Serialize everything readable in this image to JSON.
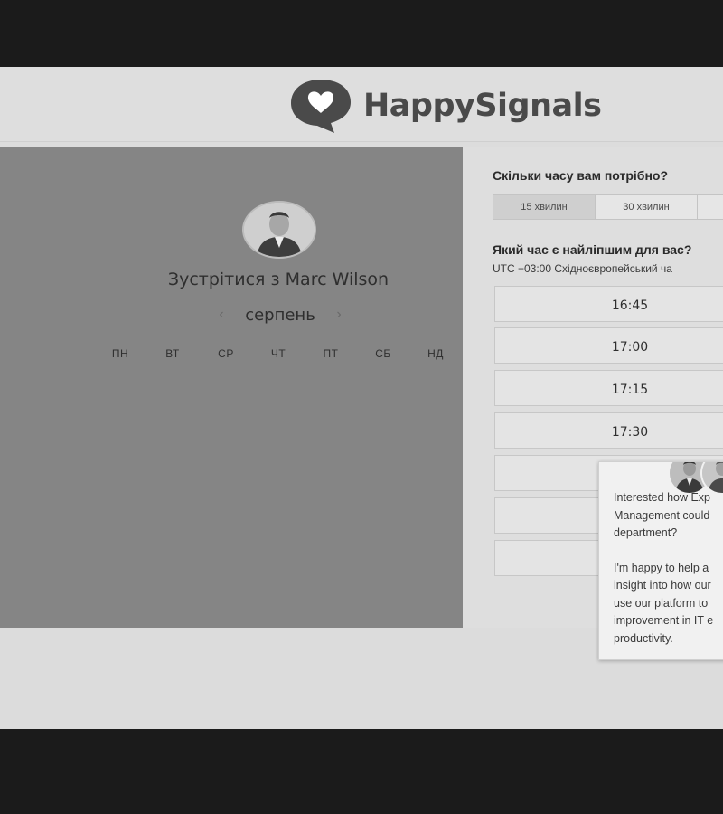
{
  "header": {
    "logo_text": "HappySignals"
  },
  "left_panel": {
    "meet_title": "Зустрітися з Marc Wilson",
    "month": "серпень",
    "prev_icon": "chevron-left-icon",
    "next_icon": "chevron-right-icon",
    "weekdays": [
      "ПН",
      "ВТ",
      "СР",
      "ЧТ",
      "ПТ",
      "СБ",
      "НД"
    ]
  },
  "booking": {
    "duration_question": "Скільки часу вам потрібно?",
    "durations": [
      "15 хвилин",
      "30 хвилин"
    ],
    "selected_duration": "15 хвилин",
    "time_question": "Який час є найліпшим для вас?",
    "timezone": "UTC +03:00 Східноєвропейський ча",
    "slots": [
      "16:45",
      "17:00",
      "17:15",
      "17:30",
      "",
      "",
      ""
    ]
  },
  "chat": {
    "message_1": "Interested how Exp\nManagement could\ndepartment?",
    "message_2": "I'm happy to help a\ninsight into how our\nuse our platform to\nimprovement in IT e\nproductivity."
  },
  "colors": {
    "background": "#1b1b1b",
    "panel_gray": "#858585",
    "page": "#dcdcdc",
    "logo_text": "#4a4a4a"
  }
}
